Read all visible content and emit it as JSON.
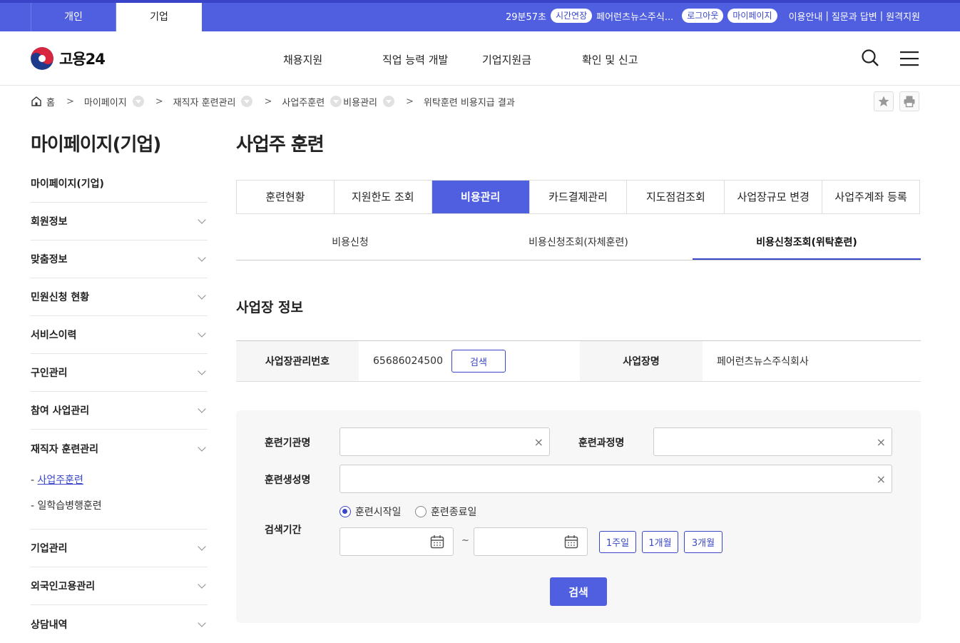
{
  "topbar": {
    "tab_personal": "개인",
    "tab_business": "기업",
    "timer": "29분57초",
    "extend_label": "시간연장",
    "company": "페어런츠뉴스주식...",
    "logout_label": "로그아웃",
    "mypage_label": "마이페이지",
    "guide": "이용안내",
    "qna": "질문과 답변",
    "remote": "원격지원",
    "sep": "|"
  },
  "header": {
    "logo_text": "고용24",
    "nav": [
      "채용지원",
      "직업 능력 개발",
      "기업지원금",
      "확인 및 신고"
    ]
  },
  "breadcrumb": [
    "홈",
    "마이페이지",
    "재직자 훈련관리",
    "사업주훈련",
    "비용관리",
    "위탁훈련 비용지급 결과"
  ],
  "sidebar": {
    "title": "마이페이지(기업)",
    "items": [
      "마이페이지(기업)",
      "회원정보",
      "맞춤정보",
      "민원신청 현황",
      "서비스이력",
      "구인관리",
      "참여 사업관리",
      "재직자 훈련관리",
      "기업관리",
      "외국인고용관리",
      "상담내역"
    ],
    "subitems": [
      "- ",
      "사업주훈련",
      "- 일학습병행훈련"
    ]
  },
  "main": {
    "title": "사업주 훈련",
    "tabs": [
      "훈련현황",
      "지원한도 조회",
      "비용관리",
      "카드결제관리",
      "지도점검조회",
      "사업장규모 변경",
      "사업주계좌 등록"
    ],
    "subtabs": [
      "비용신청",
      "비용신청조회(자체훈련)",
      "비용신청조회(위탁훈련)"
    ],
    "section_title": "사업장 정보",
    "info": {
      "mgmt_no_label": "사업장관리번호",
      "mgmt_no": "65686024500",
      "search_btn": "검색",
      "name_label": "사업장명",
      "name": "페어런츠뉴스주식회사"
    },
    "search": {
      "institution_label": "훈련기관명",
      "course_label": "훈련과정명",
      "trainee_label": "훈련생성명",
      "period_label": "검색기간",
      "radio_start": "훈련시작일",
      "radio_end": "훈련종료일",
      "tilde": "~",
      "week1": "1주일",
      "month1": "1개월",
      "month3": "3개월",
      "submit": "검색",
      "clear": "×"
    }
  },
  "colors": {
    "primary": "#4f5fe0",
    "accent": "#3946c9"
  }
}
